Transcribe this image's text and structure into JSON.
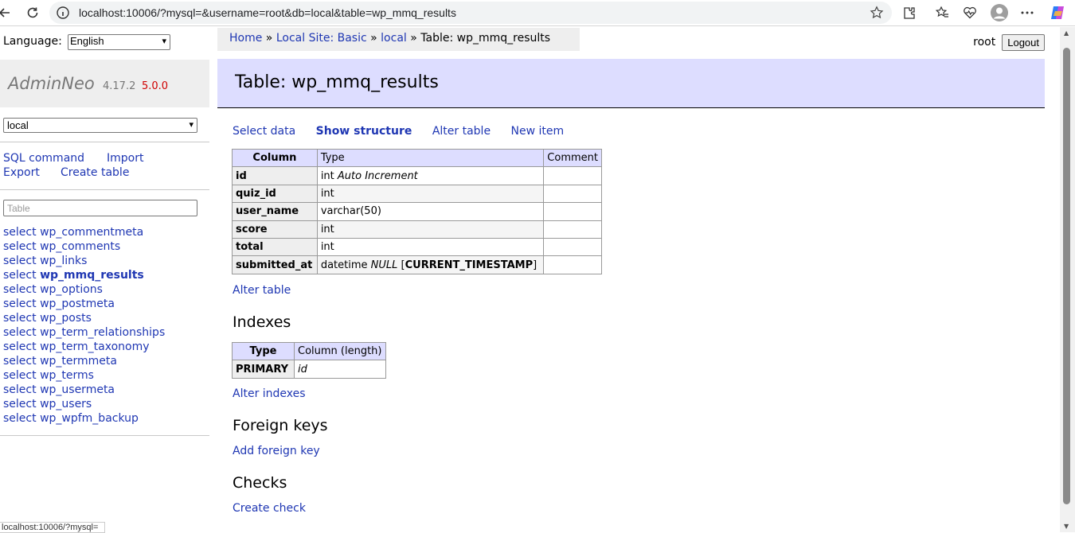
{
  "browser": {
    "url": "localhost:10006/?mysql=&username=root&db=local&table=wp_mmq_results",
    "status_url": "localhost:10006/?mysql="
  },
  "sidebar": {
    "language_label": "Language:",
    "language_value": "English",
    "brand": "AdminNeo",
    "version": "4.17.2",
    "new_version": "5.0.0",
    "db_value": "local",
    "links": {
      "sql_command": "SQL command",
      "import": "Import",
      "export": "Export",
      "create_table": "Create table"
    },
    "filter_placeholder": "Table",
    "select_prefix": "select",
    "tables": [
      "wp_commentmeta",
      "wp_comments",
      "wp_links",
      "wp_mmq_results",
      "wp_options",
      "wp_postmeta",
      "wp_posts",
      "wp_term_relationships",
      "wp_term_taxonomy",
      "wp_termmeta",
      "wp_terms",
      "wp_usermeta",
      "wp_users",
      "wp_wpfm_backup"
    ]
  },
  "breadcrumb": {
    "home": "Home",
    "server": "Local Site: Basic",
    "db": "local",
    "current": "Table: wp_mmq_results",
    "sep": "»"
  },
  "user": {
    "name": "root",
    "logout": "Logout"
  },
  "main": {
    "title": "Table: wp_mmq_results",
    "nav": {
      "select_data": "Select data",
      "show_structure": "Show structure",
      "alter_table": "Alter table",
      "new_item": "New item"
    },
    "columns_headers": {
      "column": "Column",
      "type": "Type",
      "comment": "Comment"
    },
    "columns": [
      {
        "name": "id",
        "type": "int",
        "extra": "Auto Increment",
        "default": ""
      },
      {
        "name": "quiz_id",
        "type": "int",
        "extra": "",
        "default": ""
      },
      {
        "name": "user_name",
        "type": "varchar(50)",
        "extra": "",
        "default": ""
      },
      {
        "name": "score",
        "type": "int",
        "extra": "",
        "default": ""
      },
      {
        "name": "total",
        "type": "int",
        "extra": "",
        "default": ""
      },
      {
        "name": "submitted_at",
        "type": "datetime",
        "extra": "NULL",
        "default": "CURRENT_TIMESTAMP"
      }
    ],
    "alter_table_link": "Alter table",
    "indexes_title": "Indexes",
    "indexes_headers": {
      "type": "Type",
      "column": "Column (length)"
    },
    "indexes": [
      {
        "type": "PRIMARY",
        "column": "id"
      }
    ],
    "alter_indexes_link": "Alter indexes",
    "foreign_keys_title": "Foreign keys",
    "add_foreign_key_link": "Add foreign key",
    "checks_title": "Checks",
    "create_check_link": "Create check"
  }
}
